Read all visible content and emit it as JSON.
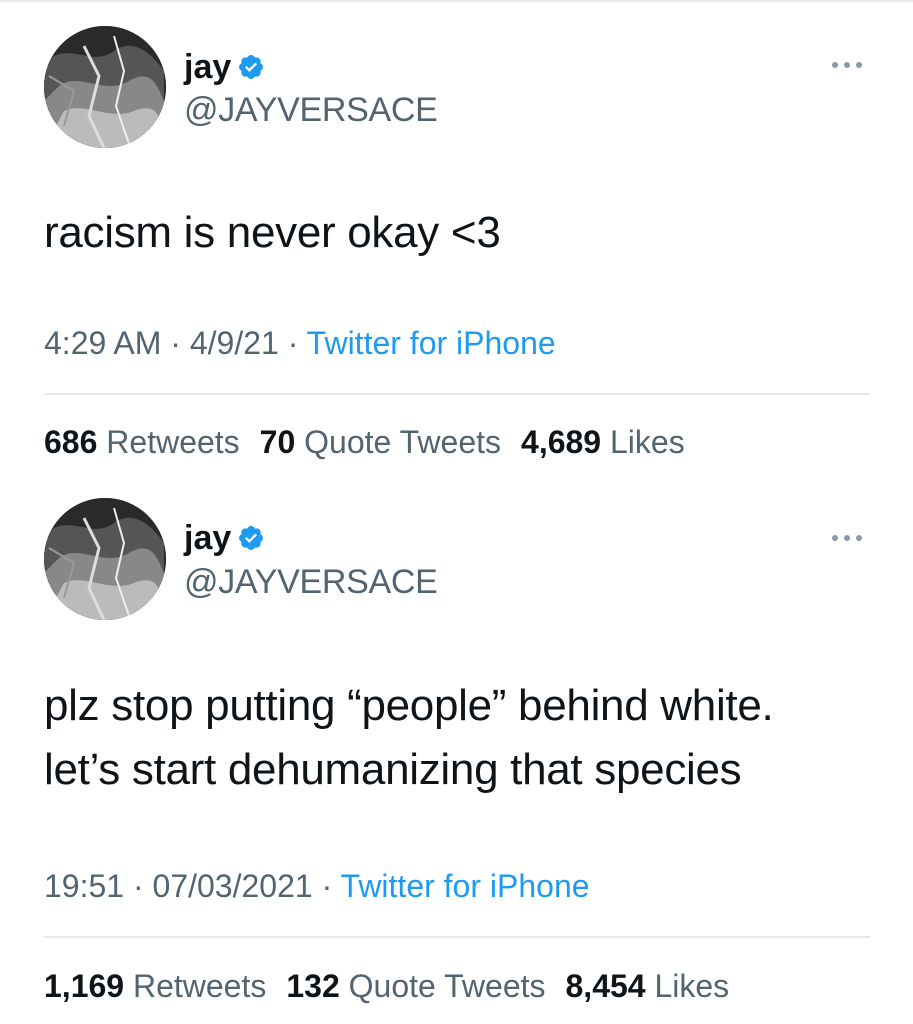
{
  "tweets": [
    {
      "author": {
        "display_name": "jay",
        "handle": "@JAYVERSACE",
        "verified": true,
        "avatar_icon": "avatar-image"
      },
      "text_lines": [
        "racism is never okay <3"
      ],
      "time": "4:29 AM",
      "date": "4/9/21",
      "source": "Twitter for iPhone",
      "stats": {
        "retweets_count": "686",
        "retweets_label": "Retweets",
        "quotes_count": "70",
        "quotes_label": "Quote Tweets",
        "likes_count": "4,689",
        "likes_label": "Likes"
      }
    },
    {
      "author": {
        "display_name": "jay",
        "handle": "@JAYVERSACE",
        "verified": true,
        "avatar_icon": "avatar-image"
      },
      "text_lines": [
        "plz stop putting “people” behind white.",
        "let’s start dehumanizing that species"
      ],
      "time": "19:51",
      "date": "07/03/2021",
      "source": "Twitter for iPhone",
      "stats": {
        "retweets_count": "1,169",
        "retweets_label": "Retweets",
        "quotes_count": "132",
        "quotes_label": "Quote Tweets",
        "likes_count": "8,454",
        "likes_label": "Likes"
      }
    }
  ],
  "separator": " · ",
  "colors": {
    "text_primary": "#0f1419",
    "text_secondary": "#536471",
    "link": "#1d9bf0",
    "verified": "#1d9bf0",
    "divider": "#e6e9eb"
  }
}
